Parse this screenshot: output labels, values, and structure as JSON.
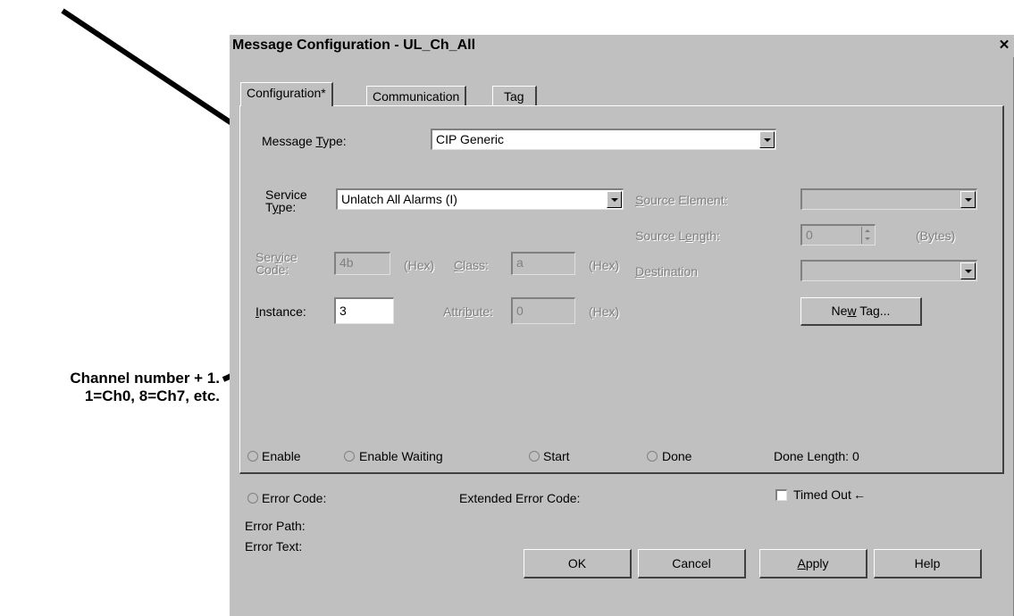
{
  "annotations": {
    "channel_note_line1": "Channel number + 1.",
    "channel_note_line2": "1=Ch0, 8=Ch7, etc."
  },
  "dialog": {
    "title": "Message Configuration - UL_Ch_All",
    "close_glyph": "✕",
    "tabs": [
      {
        "label": "Configuration*",
        "active": true
      },
      {
        "label": "Communication",
        "active": false
      },
      {
        "label": "Tag",
        "active": false
      }
    ]
  },
  "config": {
    "message_type_label": "Message Type:",
    "message_type_value": "CIP Generic",
    "service_type_label_1": "Service",
    "service_type_label_2": "Type:",
    "service_type_value": "Unlatch All Alarms (I)",
    "service_code_label_1": "Service",
    "service_code_label_2": "Code:",
    "service_code_value": "4b",
    "hex_unit": "(Hex)",
    "class_label": "Class:",
    "class_value": "a",
    "instance_label": "Instance:",
    "instance_value": "3",
    "attribute_label": "Attribute:",
    "attribute_value": "0",
    "source_element_label": "Source Element:",
    "source_element_value": "",
    "source_length_label": "Source Length:",
    "source_length_value": "0",
    "bytes_unit": "(Bytes)",
    "destination_label": "Destination",
    "destination_value": "",
    "new_tag_button": "New Tag..."
  },
  "status": {
    "enable": "Enable",
    "enable_waiting": "Enable Waiting",
    "start": "Start",
    "done": "Done",
    "done_length": "Done Length: 0",
    "error_code": "Error Code:",
    "extended_error_code": "Extended Error Code:",
    "timed_out": "Timed Out",
    "timed_out_arrow": "←",
    "error_path": "Error Path:",
    "error_text": "Error Text:"
  },
  "buttons": {
    "ok": "OK",
    "cancel": "Cancel",
    "apply": "Apply",
    "help": "Help"
  }
}
